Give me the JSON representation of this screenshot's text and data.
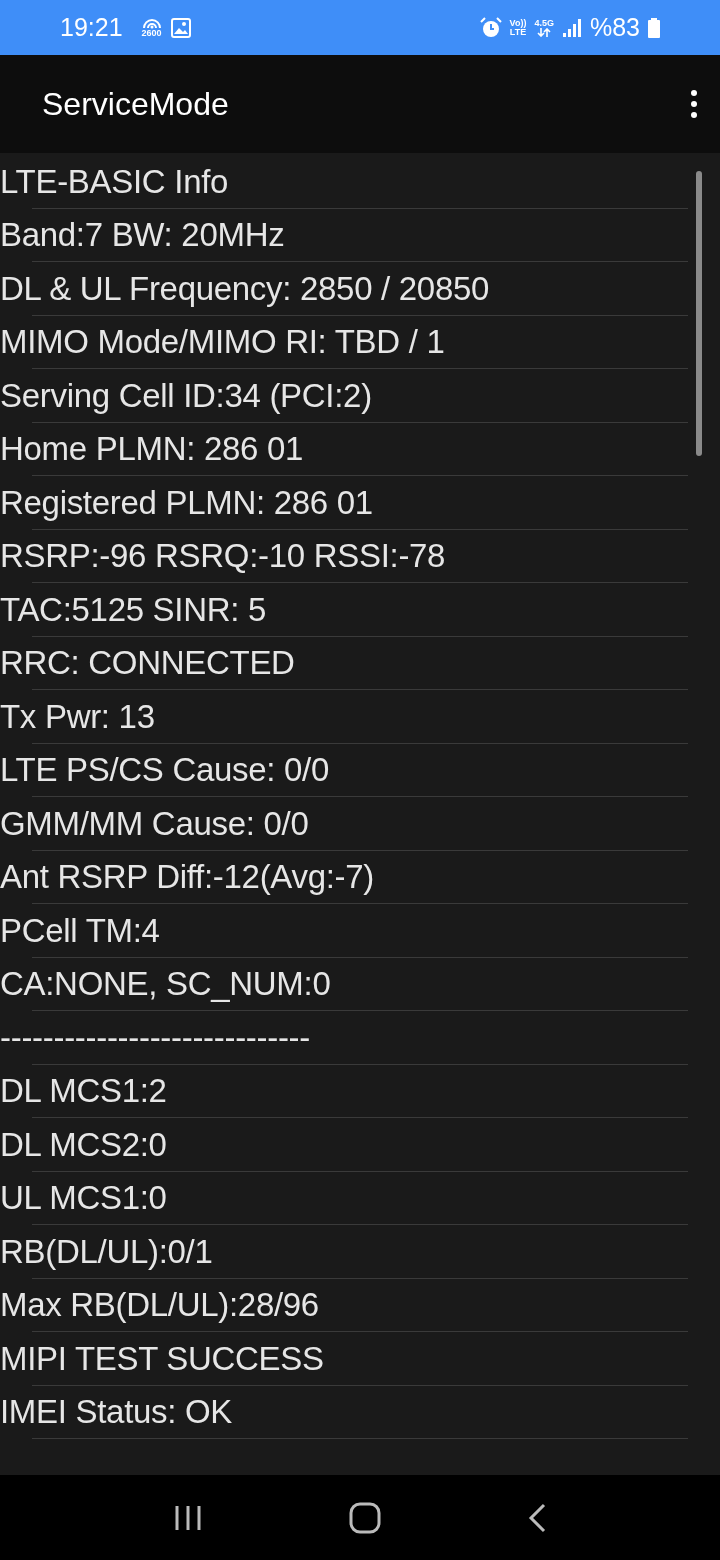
{
  "status_bar": {
    "time": "19:21",
    "hotspot_label": "2600",
    "volte_top": "Vo))",
    "volte_bottom": "LTE",
    "network_type": "4.5G",
    "battery": "%83"
  },
  "app_bar": {
    "title": "ServiceMode"
  },
  "items": [
    "LTE-BASIC Info",
    "Band:7 BW: 20MHz",
    "DL & UL Frequency: 2850 / 20850",
    "MIMO Mode/MIMO RI: TBD / 1",
    "Serving Cell ID:34 (PCI:2)",
    "Home PLMN: 286 01",
    "Registered PLMN: 286 01",
    "RSRP:-96 RSRQ:-10 RSSI:-78",
    "TAC:5125 SINR: 5",
    "RRC: CONNECTED",
    "Tx Pwr: 13",
    "LTE PS/CS Cause: 0/0",
    "GMM/MM Cause: 0/0",
    "Ant RSRP Diff:-12(Avg:-7)",
    "PCell TM:4",
    "CA:NONE, SC_NUM:0",
    "-----------------------------",
    "DL MCS1:2",
    "DL MCS2:0",
    "UL MCS1:0",
    "RB(DL/UL):0/1",
    "Max RB(DL/UL):28/96",
    "MIPI TEST SUCCESS",
    "IMEI Status: OK"
  ]
}
